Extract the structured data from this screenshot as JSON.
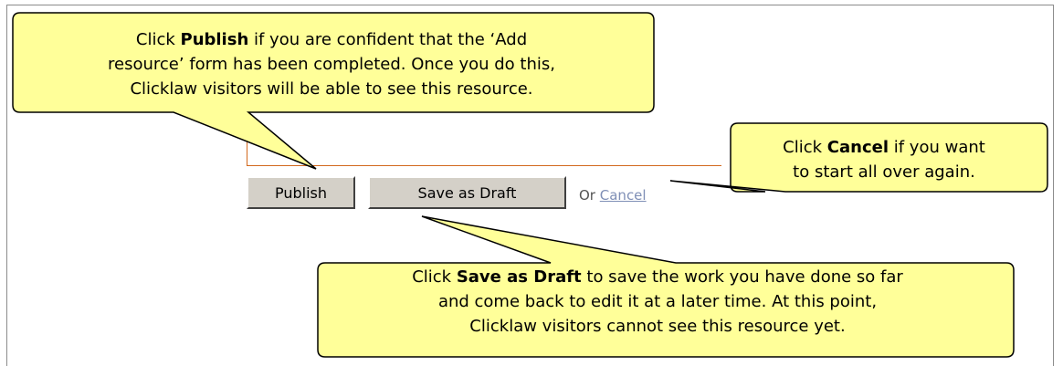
{
  "buttons": {
    "publish": "Publish",
    "save_draft": "Save as Draft"
  },
  "or_text": "Or",
  "cancel_link": "Cancel",
  "callouts": {
    "publish": {
      "prefix": "Click ",
      "bold": "Publish",
      "line1_rest": " if you are confident that the ‘Add",
      "line2": "resource’ form has been completed. Once you do this,",
      "line3": "Clicklaw visitors will be able to see this resource."
    },
    "cancel": {
      "prefix": "Click ",
      "bold": "Cancel",
      "line1_rest": " if you want",
      "line2": "to start all over again."
    },
    "save_draft": {
      "prefix": "Click ",
      "bold": "Save as Draft",
      "line1_rest": " to save the work you have done so far",
      "line2": "and come back to edit it at a later time. At this point,",
      "line3": "Clicklaw visitors cannot see this resource yet."
    }
  },
  "colors": {
    "callout_fill": "#ffff99",
    "callout_stroke": "#000000",
    "form_edge": "#d2691e",
    "button_face": "#d4d0c8",
    "link": "#7f8fb6"
  }
}
